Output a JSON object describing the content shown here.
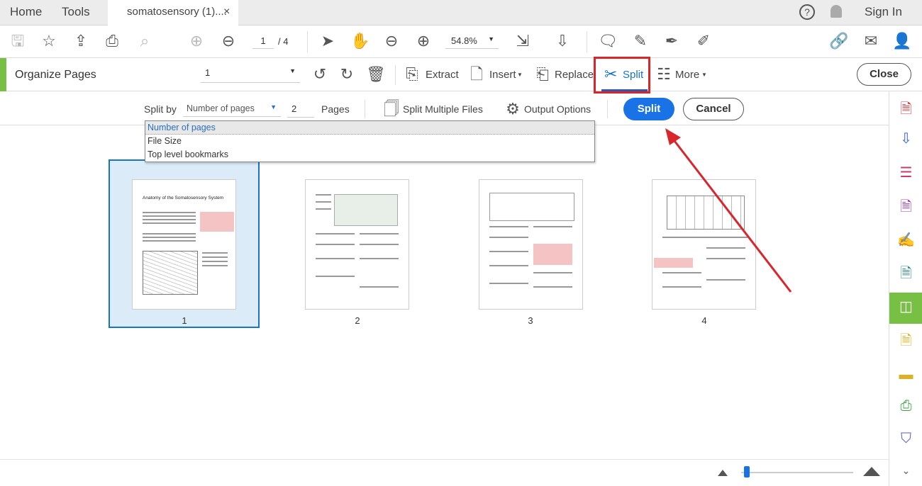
{
  "tabs": {
    "home": "Home",
    "tools": "Tools",
    "document": "somatosensory (1)....",
    "close_tab": "×"
  },
  "header": {
    "help": "?",
    "sign_in": "Sign In"
  },
  "toolbar": {
    "page_current": "1",
    "page_total": "/ 4",
    "zoom": "54.8%"
  },
  "organize": {
    "title": "Organize Pages",
    "page_select": "1",
    "extract": "Extract",
    "insert": "Insert",
    "replace": "Replace",
    "split": "Split",
    "more": "More",
    "close": "Close"
  },
  "split_bar": {
    "split_by_label": "Split by",
    "split_by_value": "Number of pages",
    "pages_count": "2",
    "pages_label": "Pages",
    "split_multiple": "Split Multiple Files",
    "output_options": "Output Options",
    "split_button": "Split",
    "cancel_button": "Cancel"
  },
  "dropdown": {
    "options": [
      "Number of pages",
      "File Size",
      "Top level bookmarks"
    ],
    "selected": "Number of pages"
  },
  "pages": [
    {
      "number": "1",
      "title": "Anatomy of the Somatosensory System",
      "selected": true
    },
    {
      "number": "2"
    },
    {
      "number": "3"
    },
    {
      "number": "4"
    }
  ],
  "colors": {
    "accent": "#1473e6",
    "organize_green": "#78c043",
    "annotation_red": "#d9252c"
  }
}
